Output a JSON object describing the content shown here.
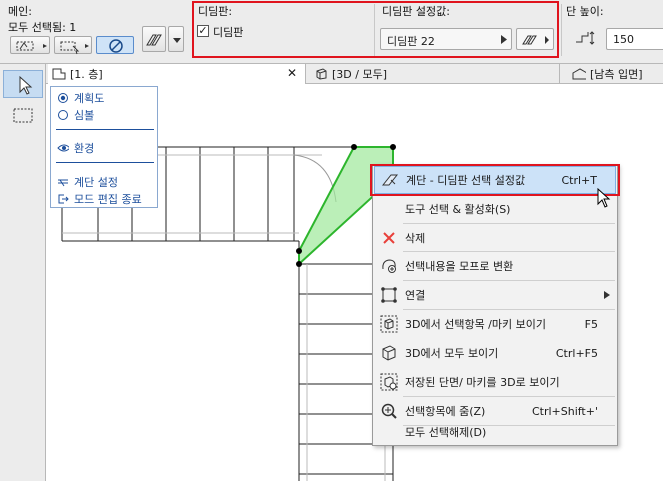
{
  "infobox": {
    "main_panel": {
      "title": "메인:",
      "selection": "모두 선택됨: 1"
    },
    "tread_panel": {
      "title": "디딤판:",
      "checkbox_label": "디딤판",
      "checked": true
    },
    "tread_settings": {
      "title": "디딤판 설정값:",
      "value": "디딤판 22"
    },
    "riser_height": {
      "title": "단 높이:",
      "value": "150"
    }
  },
  "tabs": [
    {
      "label": "[1. 층]",
      "icon": "floorplan-icon"
    },
    {
      "label": "[3D / 모두]",
      "icon": "3d-box-icon"
    },
    {
      "label": "[남측 입면]",
      "icon": "elevation-house-icon"
    }
  ],
  "quick_options": {
    "radio_items": [
      {
        "label": "계획도",
        "selected": true
      },
      {
        "label": "심볼",
        "selected": false
      }
    ],
    "view_item": "환경",
    "stair_settings": "계단 설정",
    "exit_edit": "모드 편집 종료"
  },
  "context_menu": {
    "items": [
      {
        "label": "계단 - 디딤판 선택 설정값",
        "shortcut": "Ctrl+T",
        "icon": "stair-settings-icon",
        "highlighted": true
      },
      {
        "label": "도구 선택 & 활성화(S)",
        "shortcut": "",
        "icon": "",
        "highlighted": false
      },
      {
        "label": "삭제",
        "shortcut": "",
        "icon": "delete-x-icon",
        "highlighted": false
      },
      {
        "label": "선택내용을 모프로 변환",
        "shortcut": "",
        "icon": "morph-convert-icon",
        "highlighted": false
      },
      {
        "label": "연결",
        "shortcut": "",
        "icon": "connect-icon",
        "highlighted": false,
        "submenu": true
      },
      {
        "label": "3D에서 선택항목 /마키 보이기",
        "shortcut": "F5",
        "icon": "show-selection-3d-icon",
        "highlighted": false
      },
      {
        "label": "3D에서 모두 보이기",
        "shortcut": "Ctrl+F5",
        "icon": "show-all-3d-icon",
        "highlighted": false
      },
      {
        "label": "저장된 단면/ 마키를 3D로 보이기",
        "shortcut": "",
        "icon": "saved-section-3d-icon",
        "highlighted": false
      },
      {
        "label": "선택항목에 줌(Z)",
        "shortcut": "Ctrl+Shift+'",
        "icon": "zoom-selection-icon",
        "highlighted": false
      },
      {
        "label": "모두 선택해제(D)",
        "shortcut": "",
        "icon": "",
        "highlighted": false
      }
    ]
  },
  "colors": {
    "highlight_border": "#e0141e",
    "selected_tread_fill": "#9ee89a",
    "selected_tread_stroke": "#2db52d",
    "menu_highlight": "#cce2f8",
    "link_blue": "#1d4f9c"
  }
}
